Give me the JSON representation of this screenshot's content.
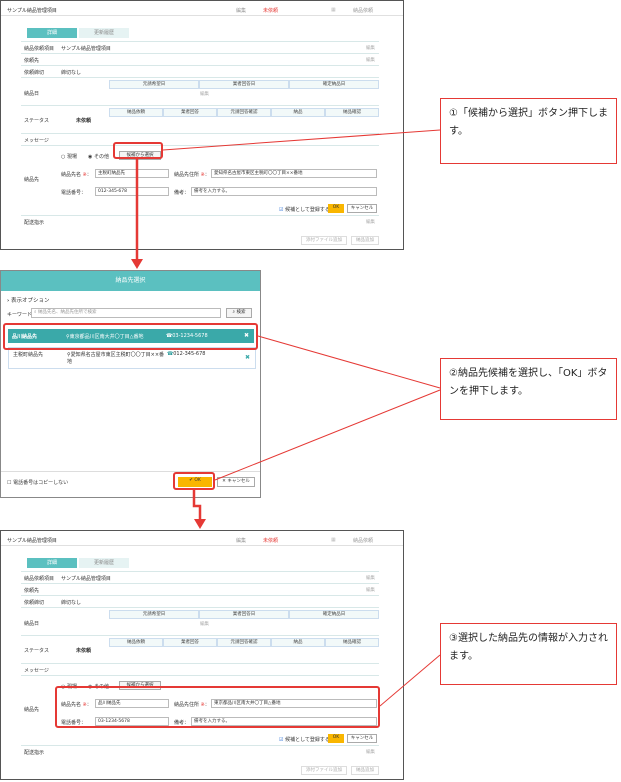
{
  "panel": {
    "title": "サンプル納品管理項目",
    "edit": "編集",
    "status_pending": "未依頼",
    "deliver_button": "納品依頼",
    "tabs": [
      "詳細",
      "更新履歴"
    ],
    "fields": {
      "delivery_item_label": "納品依頼項目",
      "delivery_item_value": "サンプル納品管理項目",
      "requester_label": "依頼先",
      "deadline_label": "依頼締切",
      "deadline_value": "締切なし",
      "delivery_date_label": "納品日",
      "status_label": "ステータス",
      "status_value": "未依頼",
      "message_label": "メッセージ",
      "destination_label": "納品先",
      "instruction_label": "配送指示"
    },
    "date_headers": [
      "元請希望日",
      "業者回答日",
      "確定納品日"
    ],
    "status_headers": [
      "納品依頼",
      "業者回答",
      "元請回答確認",
      "納品",
      "納品確認"
    ],
    "radio_current": "現場",
    "radio_other": "その他",
    "select_candidate": "候補から選択",
    "name_label": "納品先名",
    "address_label": "納品先住所",
    "phone_label": "電話番号：",
    "note_label": "備考：",
    "note_placeholder": "備考を入力する。",
    "register_candidate": "候補として登録する",
    "ok": "OK",
    "cancel": "キャンセル",
    "attach": "添付ファイル追加",
    "delivery_add": "納品追加"
  },
  "before": {
    "name": "主税町納品先",
    "address": "愛知県名古屋市東区主税町〇〇丁目××番地",
    "phone": "012-345-678"
  },
  "after": {
    "name": "品川納品先",
    "address": "東京都品川区南大井〇丁目△番地",
    "phone": "03-1234-5678"
  },
  "modal": {
    "title": "納品先選択",
    "options": "表示オプション",
    "keyword_label": "キーワード",
    "search_placeholder": "納品先名、納品先住所で検索",
    "search_button": "検索",
    "candidates": [
      {
        "name": "品川納品先",
        "address": "東京都品川区南大井〇丁目△番地",
        "phone": "03-1234-5678"
      },
      {
        "name": "主税町納品先",
        "address": "愛知県名古屋市東区主税町〇〇丁目××番地",
        "phone": "012-345-678"
      }
    ],
    "no_copy_phone": "電話番号はコピーしない",
    "ok": "OK",
    "cancel": "キャンセル"
  },
  "callouts": {
    "c1": "①「候補から選択」ボタン押下します。",
    "c2": "②納品先候補を選択し、「OK」ボタンを押下します。",
    "c3": "③選択した納品先の情報が入力されます。"
  },
  "colors": {
    "accent": "#5bc0c0",
    "red": "#e53935",
    "ok_button": "#f9b600"
  }
}
